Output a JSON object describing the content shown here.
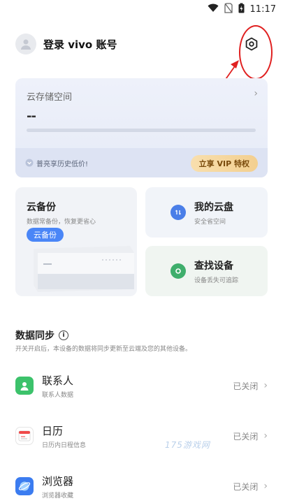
{
  "status_bar": {
    "time": "11:17"
  },
  "header": {
    "login_label": "登录 vivo 账号"
  },
  "storage": {
    "title": "云存储空间",
    "value": "--",
    "promo": "普亮享历史低价!",
    "vip_button": "立享 VIP 特权"
  },
  "tiles": {
    "backup": {
      "title": "云备份",
      "subtitle": "数据常备份，恢复更省心",
      "button": "云备份"
    },
    "disk": {
      "title": "我的云盘",
      "subtitle": "安全省空间"
    },
    "find": {
      "title": "查找设备",
      "subtitle": "设备丢失可追踪"
    }
  },
  "sync": {
    "title": "数据同步",
    "description": "开关开启后，本设备的数据将同步更新至云端及您的其他设备。",
    "items": [
      {
        "title": "联系人",
        "subtitle": "联系人数据",
        "status": "已关闭"
      },
      {
        "title": "日历",
        "subtitle": "日历内日程信息",
        "status": "已关闭"
      },
      {
        "title": "浏览器",
        "subtitle": "浏览器收藏",
        "status": "已关闭"
      }
    ]
  },
  "watermark": "175游戏网",
  "colors": {
    "accent": "#4a86f7",
    "contact_green": "#3cc26b",
    "annotation_red": "#e02020"
  }
}
